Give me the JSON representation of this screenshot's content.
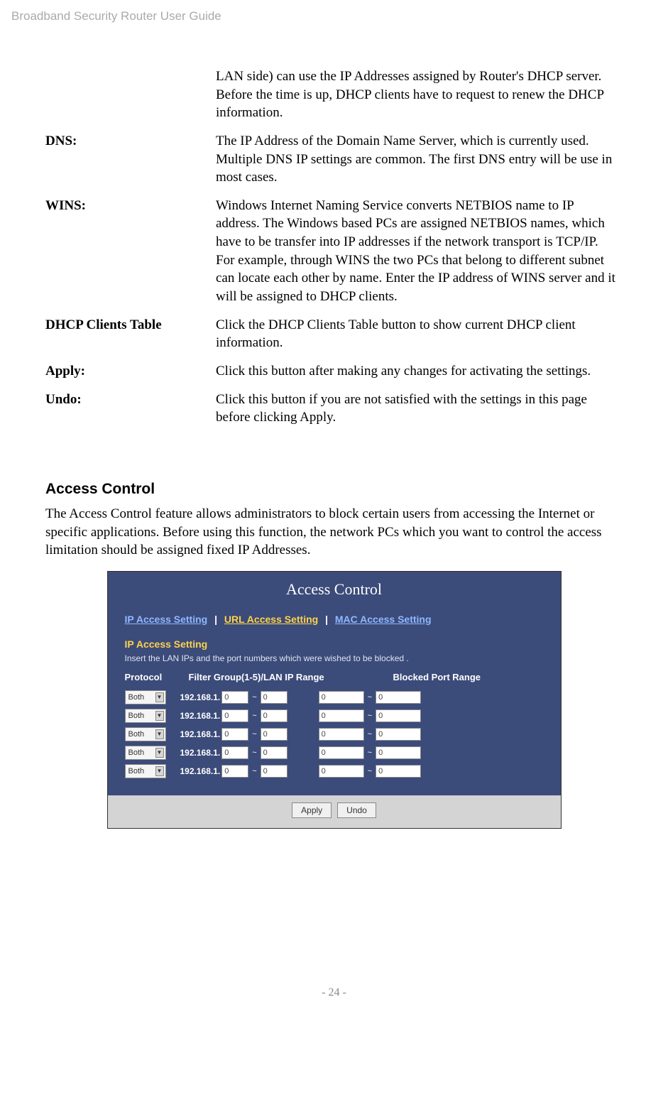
{
  "header": "Broadband Security Router User Guide",
  "definitions": {
    "top_continuation": "LAN side) can use the IP Addresses assigned by Router's DHCP server. Before the time is up, DHCP clients have to request to renew the DHCP information.",
    "dns": {
      "label": "DNS:",
      "desc": "The IP Address of the Domain Name Server, which is currently used. Multiple DNS IP settings are common. The first DNS entry will be use in most cases."
    },
    "wins": {
      "label": "WINS:",
      "desc": "Windows Internet Naming Service converts NETBIOS name to IP address. The Windows based PCs are assigned NETBIOS names, which have to be transfer into IP addresses if the network transport is TCP/IP. For example, through WINS the two PCs that belong to different subnet can locate each other by name. Enter the IP address of WINS server and it will be assigned to DHCP clients."
    },
    "dhcp_clients": {
      "label": "DHCP Clients Table",
      "desc": "Click the DHCP Clients Table button to show current DHCP client information."
    },
    "apply": {
      "label": "Apply:",
      "desc": "Click this button after making any changes for activating the settings."
    },
    "undo": {
      "label": "Undo:",
      "desc": "Click this button if you are not satisfied with the settings in this page before clicking Apply."
    }
  },
  "access_control": {
    "heading": "Access Control",
    "intro": "The Access Control feature allows administrators to block certain users from accessing the Internet or specific applications. Before using this function, the network PCs which you want to control the access limitation should be assigned fixed IP Addresses."
  },
  "screenshot": {
    "title": "Access Control",
    "tabs": {
      "ip": "IP Access Setting",
      "url": "URL Access Setting",
      "mac": "MAC Access Setting"
    },
    "section_heading": "IP Access Setting",
    "section_sub": "Insert the LAN IPs and the port numbers which were wished to be blocked .",
    "columns": {
      "protocol": "Protocol",
      "filter": "Filter Group(1-5)/LAN IP Range",
      "blocked": "Blocked Port Range"
    },
    "row": {
      "protocol_value": "Both",
      "ip_prefix": "192.168.1.",
      "ip_from": "0",
      "ip_to": "0",
      "port_from": "0",
      "port_to": "0",
      "tilde": "~"
    },
    "buttons": {
      "apply": "Apply",
      "undo": "Undo"
    }
  },
  "footer": "- 24 -"
}
